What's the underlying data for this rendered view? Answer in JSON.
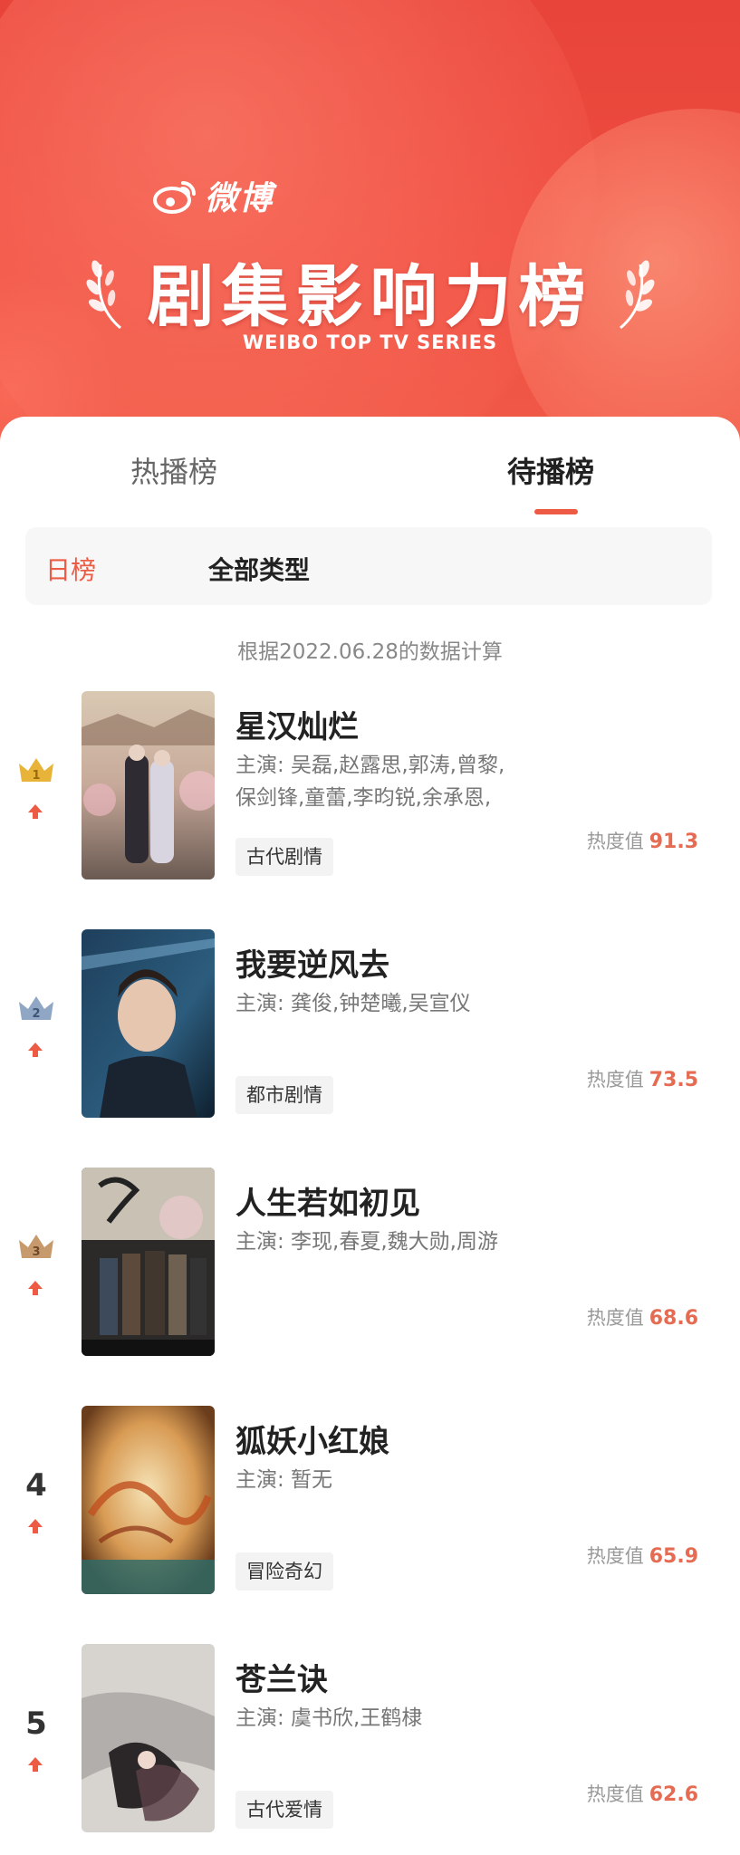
{
  "header": {
    "brand_name": "微博",
    "title": "剧集影响力榜",
    "subtitle": "WEIBO TOP TV SERIES"
  },
  "tabs": [
    {
      "label": "热播榜",
      "active": false
    },
    {
      "label": "待播榜",
      "active": true
    }
  ],
  "filter": {
    "period": "日榜",
    "category": "全部类型"
  },
  "note": "根据2022.06.28的数据计算",
  "heat_label": "热度值",
  "list": [
    {
      "rank": "1",
      "title": "星汉灿烂",
      "cast_line1": "主演: 吴磊,赵露思,郭涛,曾黎,",
      "cast_line2": "保剑锋,童蕾,李昀锐,余承恩,",
      "tag": "古代剧情",
      "heat": "91.3",
      "trend": "up",
      "crown": "gold"
    },
    {
      "rank": "2",
      "title": "我要逆风去",
      "cast_line1": "主演: 龚俊,钟楚曦,吴宣仪",
      "cast_line2": "",
      "tag": "都市剧情",
      "heat": "73.5",
      "trend": "up",
      "crown": "silver"
    },
    {
      "rank": "3",
      "title": "人生若如初见",
      "cast_line1": "主演: 李现,春夏,魏大勋,周游",
      "cast_line2": "",
      "tag": "",
      "heat": "68.6",
      "trend": "up",
      "crown": "bronze"
    },
    {
      "rank": "4",
      "title": "狐妖小红娘",
      "cast_line1": "主演: 暂无",
      "cast_line2": "",
      "tag": "冒险奇幻",
      "heat": "65.9",
      "trend": "up",
      "crown": ""
    },
    {
      "rank": "5",
      "title": "苍兰诀",
      "cast_line1": "主演: 虞书欣,王鹤棣",
      "cast_line2": "",
      "tag": "古代爱情",
      "heat": "62.6",
      "trend": "up",
      "crown": ""
    }
  ],
  "colors": {
    "accent": "#ee5b45",
    "header_red": "#ef4d40",
    "gold": "#e8b339",
    "silver": "#8fa6c4",
    "bronze": "#c79a6d"
  }
}
